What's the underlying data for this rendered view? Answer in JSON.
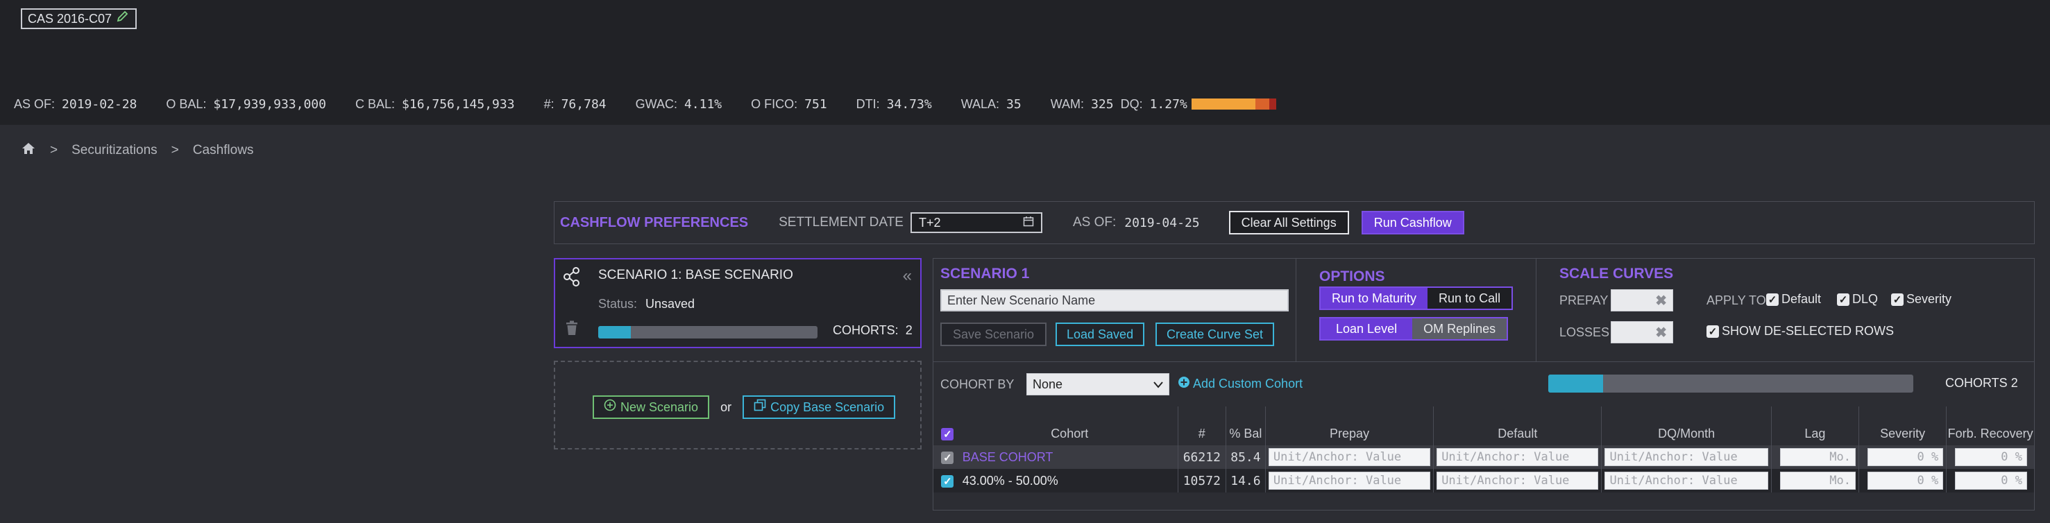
{
  "header": {
    "deal_name": "CAS 2016-C07",
    "stats": [
      {
        "label": "AS OF:",
        "value": "2019-02-28"
      },
      {
        "label": "O BAL:",
        "value": "$17,939,933,000"
      },
      {
        "label": "C BAL:",
        "value": "$16,756,145,933"
      },
      {
        "label": "#:",
        "value": "76,784"
      },
      {
        "label": "GWAC:",
        "value": "4.11%"
      },
      {
        "label": "O FICO:",
        "value": "751"
      },
      {
        "label": "DTI:",
        "value": "34.73%"
      },
      {
        "label": "WALA:",
        "value": "35"
      },
      {
        "label": "WAM:",
        "value": "325"
      },
      {
        "label": "DQ:",
        "value": "1.27%"
      }
    ],
    "dq_colors": [
      "#f2a33a",
      "#d9632b",
      "#a5271f"
    ]
  },
  "breadcrumb": {
    "home_icon": "home-icon",
    "items": [
      "Securitizations",
      "Cashflows"
    ],
    "separator": ">"
  },
  "preferences": {
    "title": "CASHFLOW PREFERENCES",
    "settlement_label": "SETTLEMENT DATE",
    "settlement_value": "T+2",
    "asof_label": "AS OF:",
    "asof_value": "2019-04-25",
    "clear_label": "Clear All Settings",
    "run_label": "Run Cashflow"
  },
  "scenario_card": {
    "title": "SCENARIO 1: BASE SCENARIO",
    "status_label": "Status:",
    "status_value": "Unsaved",
    "cohorts_label": "COHORTS:",
    "cohorts_value": "2",
    "progress": 0.15
  },
  "new_scenario": {
    "new_label": "New Scenario",
    "or_label": "or",
    "copy_label": "Copy Base Scenario"
  },
  "scenario": {
    "title": "SCENARIO 1",
    "name_placeholder": "Enter New Scenario Name",
    "save_label": "Save Scenario",
    "load_label": "Load Saved",
    "curve_label": "Create Curve Set"
  },
  "options": {
    "title": "OPTIONS",
    "run_to_maturity": "Run to Maturity",
    "run_to_call": "Run to Call",
    "loan_level": "Loan Level",
    "om_replines": "OM Replines"
  },
  "scale_curves": {
    "title": "SCALE CURVES",
    "prepay_label": "PREPAY",
    "losses_label": "LOSSES",
    "apply_to_label": "APPLY TO",
    "apply_default": "Default",
    "apply_dlq": "DLQ",
    "apply_severity": "Severity",
    "show_deselected": "SHOW DE-SELECTED ROWS"
  },
  "cohort": {
    "by_label": "COHORT BY",
    "by_value": "None",
    "add_label": "Add Custom Cohort",
    "cohorts_label": "COHORTS",
    "cohorts_value": "2",
    "progress": 0.15,
    "columns": [
      "Cohort",
      "#",
      "% Bal",
      "Prepay",
      "Default",
      "DQ/Month",
      "Lag",
      "Severity",
      "Forb. Recovery"
    ],
    "rows": [
      {
        "name": "BASE COHORT",
        "count": "66212",
        "bal": "85.4",
        "prepay": "Unit/Anchor: Value",
        "default": "Unit/Anchor: Value",
        "dq": "Unit/Anchor: Value",
        "lag": "Mo.",
        "severity": "0",
        "forb": "0"
      },
      {
        "name": "43.00% - 50.00%",
        "count": "10572",
        "bal": "14.6",
        "prepay": "Unit/Anchor: Value",
        "default": "Unit/Anchor: Value",
        "dq": "Unit/Anchor: Value",
        "lag": "Mo.",
        "severity": "0",
        "forb": "0"
      }
    ],
    "percent_unit": "%"
  }
}
